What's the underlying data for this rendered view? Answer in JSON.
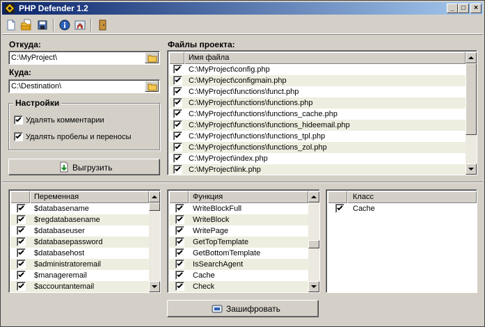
{
  "window": {
    "title": "PHP Defender 1.2"
  },
  "toolbar": {
    "icons": [
      "new-file-icon",
      "open-file-icon",
      "save-icon",
      "info-icon",
      "home-icon",
      "exit-door-icon"
    ]
  },
  "source": {
    "label": "Откуда:",
    "value": "C:\\MyProject\\"
  },
  "dest": {
    "label": "Куда:",
    "value": "C:\\Destination\\"
  },
  "settings": {
    "title": "Настройки",
    "remove_comments": "Удалять комментарии",
    "remove_spaces": "Удалять пробелы и переносы"
  },
  "export_button": "Выгрузить",
  "files": {
    "label": "Файлы проекта:",
    "column": "Имя файла",
    "rows": [
      "C:\\MyProject\\config.php",
      "C:\\MyProject\\configmain.php",
      "C:\\MyProject\\functions\\funct.php",
      "C:\\MyProject\\functions\\functions.php",
      "C:\\MyProject\\functions\\functions_cache.php",
      "C:\\MyProject\\functions\\functions_hideemail.php",
      "C:\\MyProject\\functions\\functions_tpl.php",
      "C:\\MyProject\\functions\\functions_zol.php",
      "C:\\MyProject\\index.php",
      "C:\\MyProject\\link.php"
    ]
  },
  "variables": {
    "column": "Переменная",
    "rows": [
      "$databasename",
      "$regdatabasename",
      "$databaseuser",
      "$databasepassword",
      "$databasehost",
      "$administratoremail",
      "$manageremail",
      "$accountantemail"
    ]
  },
  "functions": {
    "column": "Функция",
    "rows": [
      "WriteBlockFull",
      "WriteBlock",
      "WritePage",
      "GetTopTemplate",
      "GetBottomTemplate",
      "IsSearchAgent",
      "Cache",
      "Check"
    ]
  },
  "classes": {
    "column": "Класс",
    "rows": [
      "Cache"
    ]
  },
  "encrypt_button": "Зашифровать"
}
